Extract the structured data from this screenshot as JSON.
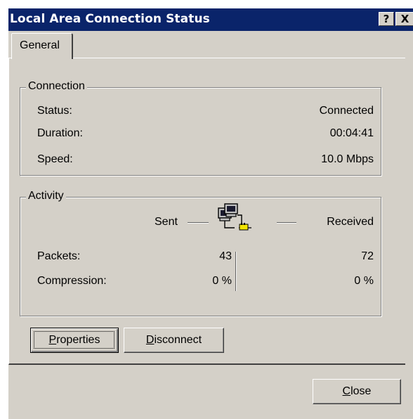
{
  "window": {
    "title": "Local Area Connection Status",
    "help_button": "?",
    "close_button": "X"
  },
  "tabs": [
    {
      "label": "General",
      "selected": true
    }
  ],
  "connection": {
    "legend": "Connection",
    "rows": [
      {
        "label": "Status:",
        "value": "Connected"
      },
      {
        "label": "Duration:",
        "value": "00:04:41"
      },
      {
        "label": "Speed:",
        "value": "10.0 Mbps"
      }
    ]
  },
  "activity": {
    "legend": "Activity",
    "sent_label": "Sent",
    "received_label": "Received",
    "rows": [
      {
        "label": "Packets:",
        "sent": "43",
        "received": "72"
      },
      {
        "label": "Compression:",
        "sent": "0 %",
        "received": "0 %"
      }
    ],
    "icon": "network-activity-icon"
  },
  "buttons": {
    "properties": {
      "mnemonic": "P",
      "rest": "roperties"
    },
    "disconnect": {
      "mnemonic": "D",
      "rest": "isconnect"
    },
    "close": {
      "mnemonic": "C",
      "rest": "lose"
    }
  },
  "colors": {
    "titlebar": "#0a246a",
    "face": "#d4d0c8"
  }
}
